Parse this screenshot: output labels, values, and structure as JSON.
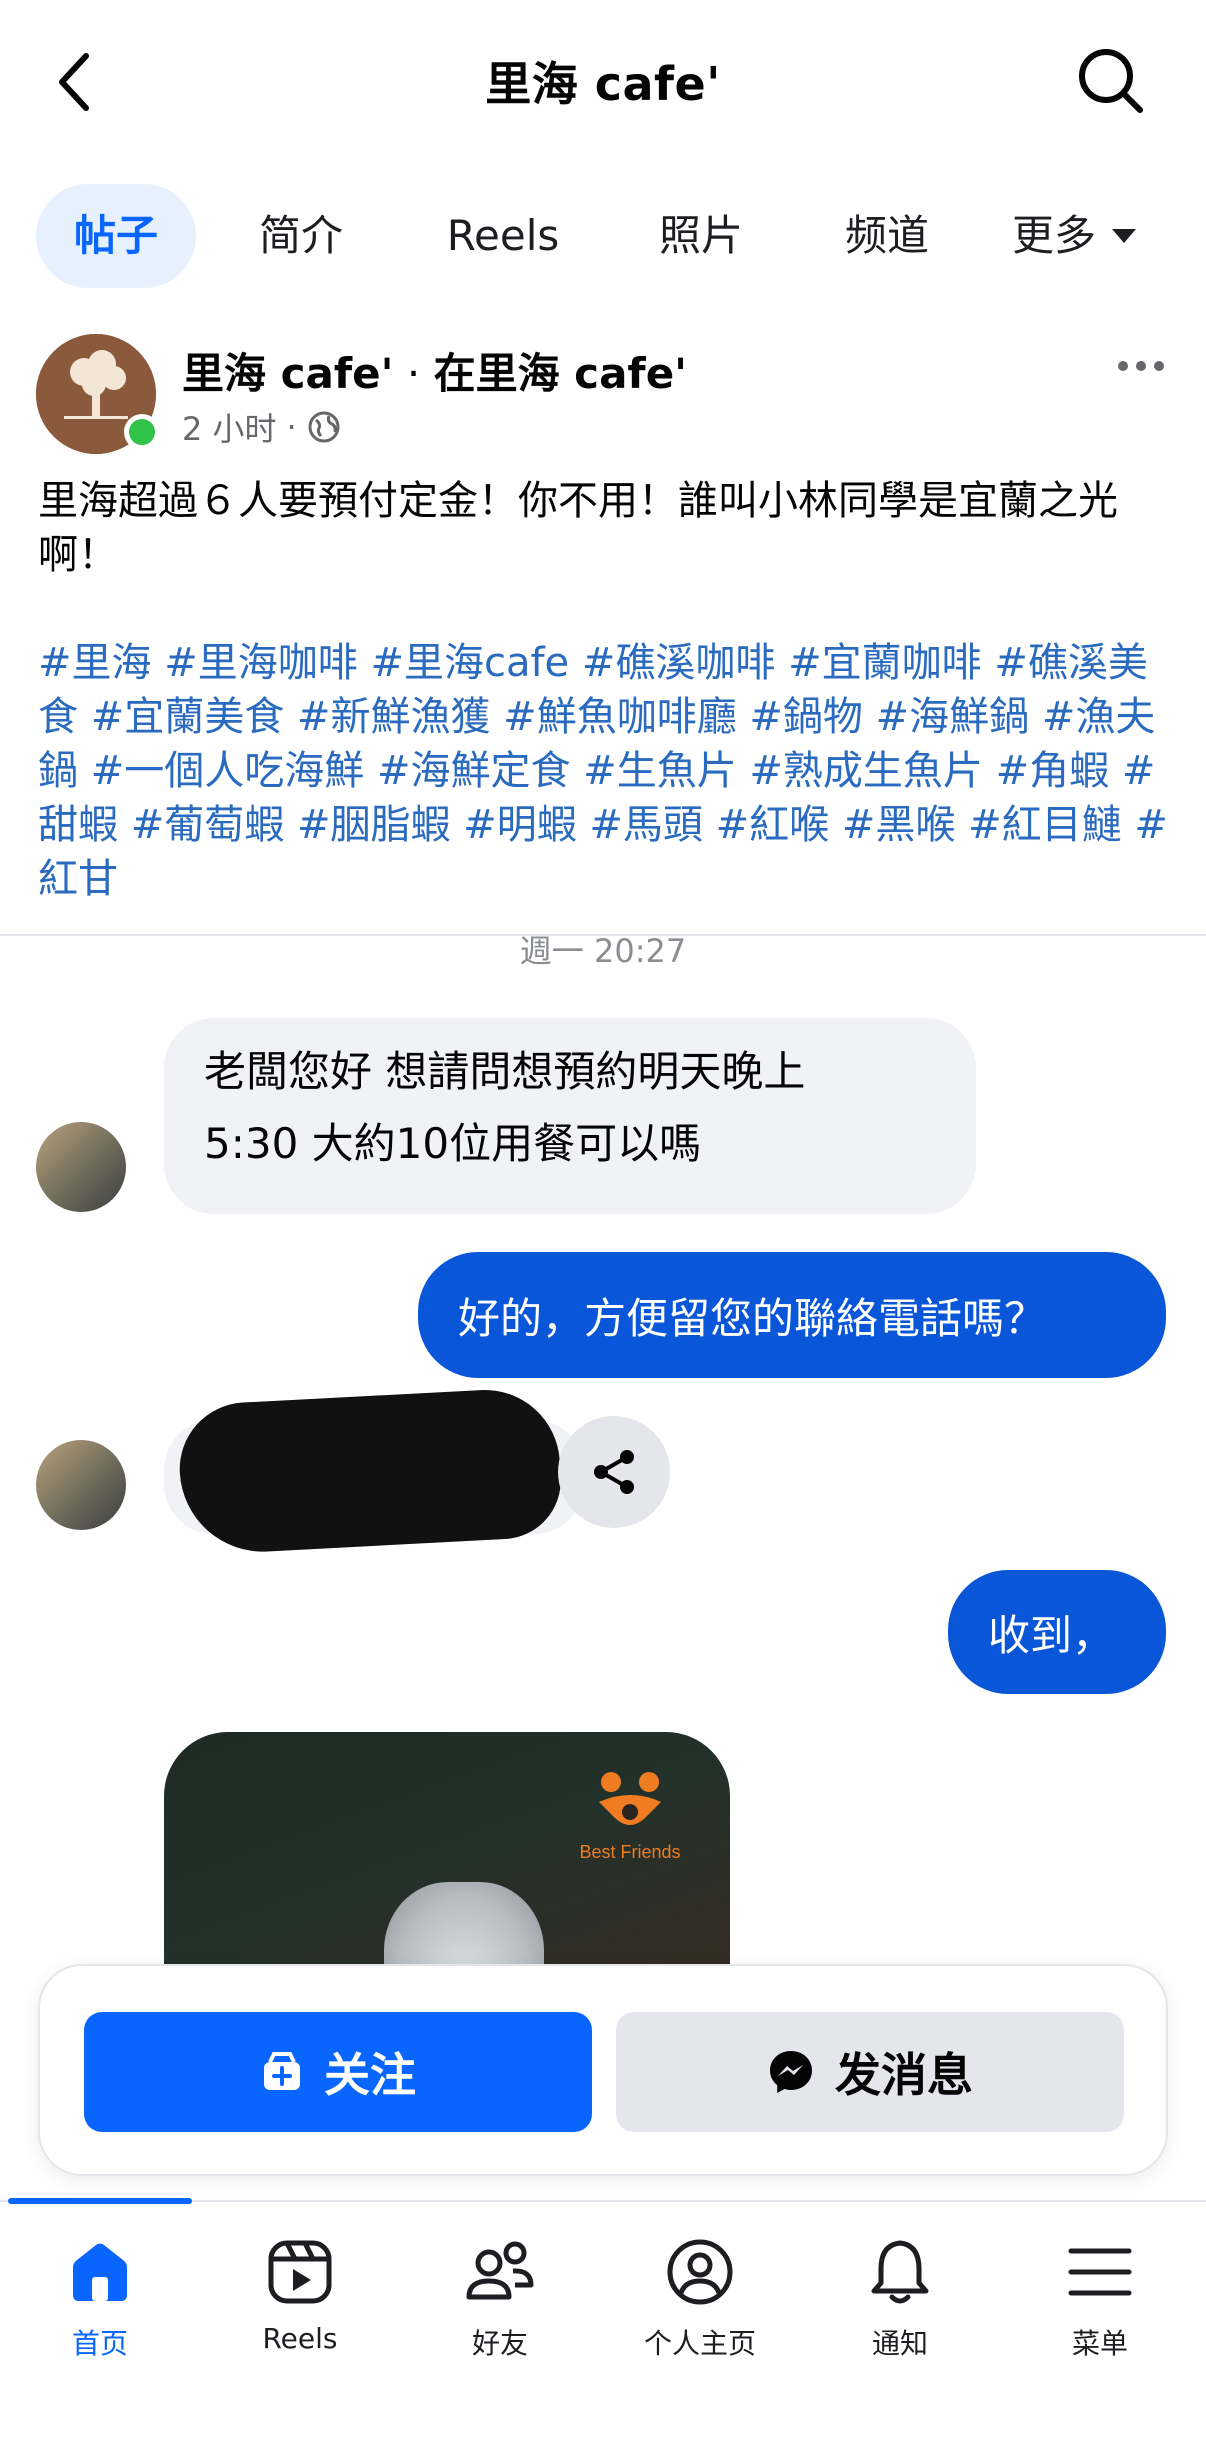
{
  "header": {
    "title": "里海 cafe'"
  },
  "tabs": [
    {
      "label": "帖子",
      "active": true
    },
    {
      "label": "简介",
      "active": false
    },
    {
      "label": "Reels",
      "active": false
    },
    {
      "label": "照片",
      "active": false
    },
    {
      "label": "频道",
      "active": false
    },
    {
      "label": "更多",
      "active": false
    }
  ],
  "post": {
    "author": "里海 cafe'",
    "location_sep": "·",
    "location": "在里海 cafe'",
    "time": "2 小时",
    "dot": "·",
    "text": "里海超過６人要預付定金！你不用！誰叫小林同學是宜蘭之光啊！",
    "hashtags": "#里海 #里海咖啡 #里海cafe #礁溪咖啡 #宜蘭咖啡 #礁溪美食 #宜蘭美食 #新鮮漁獲 #鮮魚咖啡廳 #鍋物 #海鮮鍋 #漁夫鍋 #一個人吃海鮮 #海鮮定食 #生魚片 #熟成生魚片 #角蝦 #甜蝦 #葡萄蝦 #胭脂蝦 #明蝦 #馬頭 #紅喉 #黑喉 #紅目鰱 #紅甘"
  },
  "chat": {
    "time": "週一 20:27",
    "msg1_line1": "老闆您好 想請問想預約明天晚上",
    "msg1_line2": "5:30 大約10位用餐可以嗎",
    "reply1": "好的，方便留您的聯絡電話嗎？",
    "reply2": "收到，",
    "card_brand": "Best Friends"
  },
  "actions": {
    "follow_label": "关注",
    "message_label": "发消息"
  },
  "nav": [
    {
      "label": "首页",
      "icon": "home-icon",
      "active": true
    },
    {
      "label": "Reels",
      "icon": "reels-icon",
      "active": false
    },
    {
      "label": "好友",
      "icon": "friends-icon",
      "active": false
    },
    {
      "label": "个人主页",
      "icon": "profile-icon",
      "active": false
    },
    {
      "label": "通知",
      "icon": "bell-icon",
      "active": false
    },
    {
      "label": "菜单",
      "icon": "menu-icon",
      "active": false
    }
  ],
  "colors": {
    "accent": "#0866ff",
    "hashtag": "#2a6bbf",
    "bubble_out": "#0a56d8",
    "online": "#31c24a"
  }
}
